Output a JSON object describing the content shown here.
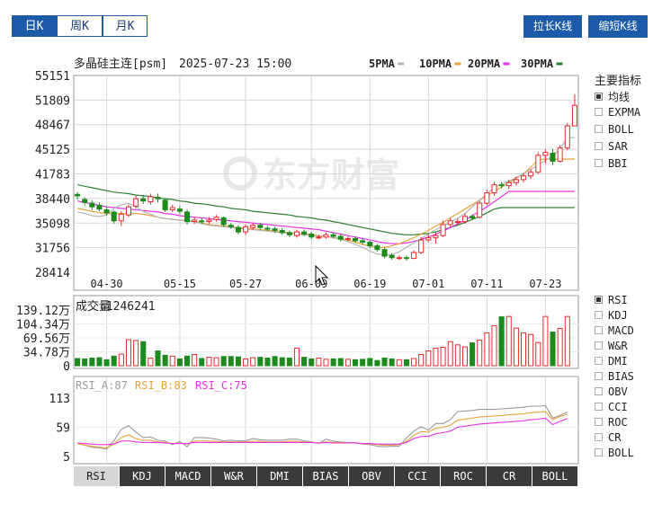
{
  "period_tabs": [
    {
      "label": "日K",
      "active": true
    },
    {
      "label": "周K",
      "active": false
    },
    {
      "label": "月K",
      "active": false
    }
  ],
  "right_buttons": {
    "stretch": "拉长K线",
    "shrink": "缩短K线"
  },
  "chart_header": {
    "name": "多晶硅主连[psm]",
    "datetime": "2025-07-23 15:00"
  },
  "ma_legend": [
    {
      "label": "5PMA",
      "color": "#b4b4b4"
    },
    {
      "label": "10PMA",
      "color": "#e8a33a"
    },
    {
      "label": "20PMA",
      "color": "#e633e6"
    },
    {
      "label": "30PMA",
      "color": "#2e7d32"
    }
  ],
  "indicator_menu": {
    "title": "主要指标",
    "items": [
      {
        "label": "均线",
        "selected": true
      },
      {
        "label": "EXPMA",
        "selected": false
      },
      {
        "label": "BOLL",
        "selected": false
      },
      {
        "label": "SAR",
        "selected": false
      },
      {
        "label": "BBI",
        "selected": false
      }
    ]
  },
  "sub_menu": {
    "items": [
      {
        "label": "RSI",
        "selected": true
      },
      {
        "label": "KDJ",
        "selected": false
      },
      {
        "label": "MACD",
        "selected": false
      },
      {
        "label": "W&R",
        "selected": false
      },
      {
        "label": "DMI",
        "selected": false
      },
      {
        "label": "BIAS",
        "selected": false
      },
      {
        "label": "OBV",
        "selected": false
      },
      {
        "label": "CCI",
        "selected": false
      },
      {
        "label": "ROC",
        "selected": false
      },
      {
        "label": "CR",
        "selected": false
      },
      {
        "label": "BOLL",
        "selected": false
      }
    ]
  },
  "bottom_tabs": [
    {
      "label": "RSI",
      "active": true
    },
    {
      "label": "KDJ",
      "active": false
    },
    {
      "label": "MACD",
      "active": false
    },
    {
      "label": "W&R",
      "active": false
    },
    {
      "label": "DMI",
      "active": false
    },
    {
      "label": "BIAS",
      "active": false
    },
    {
      "label": "OBV",
      "active": false
    },
    {
      "label": "CCI",
      "active": false
    },
    {
      "label": "ROC",
      "active": false
    },
    {
      "label": "CR",
      "active": false
    },
    {
      "label": "BOLL",
      "active": false
    }
  ],
  "watermark": "东方财富",
  "colors": {
    "up": "#e8292c",
    "down": "#1e8a1e",
    "accent": "#1d5aa8",
    "grid": "#d8d8d8"
  },
  "chart_data": {
    "type": "candlestick",
    "price_axis": {
      "ticks": [
        "55151",
        "51809",
        "48467",
        "45125",
        "41783",
        "38440",
        "35098",
        "31756",
        "28414"
      ],
      "range": [
        28414,
        55151
      ]
    },
    "x_ticks": [
      {
        "label": "04-30",
        "index": 4
      },
      {
        "label": "05-15",
        "index": 14
      },
      {
        "label": "05-27",
        "index": 23
      },
      {
        "label": "06-09",
        "index": 32
      },
      {
        "label": "06-19",
        "index": 40
      },
      {
        "label": "07-01",
        "index": 48
      },
      {
        "label": "07-11",
        "index": 56
      },
      {
        "label": "07-23",
        "index": 64
      }
    ],
    "candles": [
      [
        39000,
        38800,
        39300,
        38300
      ],
      [
        38300,
        37900,
        38600,
        37500
      ],
      [
        37800,
        37300,
        38200,
        36900
      ],
      [
        37500,
        37000,
        37900,
        36700
      ],
      [
        36900,
        36500,
        37300,
        36100
      ],
      [
        36600,
        35400,
        36800,
        35000
      ],
      [
        35400,
        36300,
        36700,
        34700
      ],
      [
        36200,
        37300,
        37600,
        35900
      ],
      [
        37400,
        38400,
        38800,
        37100
      ],
      [
        38400,
        38100,
        38900,
        37700
      ],
      [
        38000,
        38700,
        39100,
        37600
      ],
      [
        38600,
        38400,
        39100,
        37900
      ],
      [
        38200,
        36900,
        38500,
        36600
      ],
      [
        36900,
        37200,
        37600,
        36600
      ],
      [
        37000,
        36700,
        37400,
        36300
      ],
      [
        36600,
        35300,
        36900,
        34900
      ],
      [
        35300,
        35500,
        35900,
        35000
      ],
      [
        35400,
        35300,
        35800,
        35000
      ],
      [
        35300,
        35500,
        35900,
        35000
      ],
      [
        35600,
        35900,
        36200,
        35300
      ],
      [
        35800,
        34900,
        36000,
        34600
      ],
      [
        34800,
        34600,
        35100,
        34300
      ],
      [
        34500,
        33900,
        34800,
        33600
      ],
      [
        33900,
        34600,
        34900,
        33500
      ],
      [
        34500,
        34800,
        35100,
        34200
      ],
      [
        34800,
        34500,
        35100,
        34200
      ],
      [
        34400,
        34300,
        34700,
        34000
      ],
      [
        34300,
        34100,
        34600,
        33800
      ],
      [
        34100,
        33800,
        34400,
        33500
      ],
      [
        33800,
        33500,
        34100,
        33200
      ],
      [
        33400,
        33900,
        34200,
        33100
      ],
      [
        33900,
        33600,
        34200,
        33300
      ],
      [
        33600,
        33200,
        33900,
        32900
      ],
      [
        33200,
        33200,
        33500,
        32900
      ],
      [
        33200,
        33500,
        33800,
        33000
      ],
      [
        33500,
        33300,
        33800,
        33000
      ],
      [
        33300,
        32900,
        33600,
        32600
      ],
      [
        32900,
        33000,
        33300,
        32600
      ],
      [
        33000,
        32700,
        33300,
        32400
      ],
      [
        32700,
        32500,
        33000,
        32200
      ],
      [
        32500,
        32000,
        32700,
        31700
      ],
      [
        32000,
        31500,
        32300,
        31200
      ],
      [
        31500,
        30600,
        31800,
        30300
      ],
      [
        30700,
        30400,
        31000,
        30100
      ],
      [
        30400,
        30400,
        30700,
        30100
      ],
      [
        30400,
        30300,
        30700,
        30000
      ],
      [
        30300,
        31100,
        31400,
        30200
      ],
      [
        31100,
        32800,
        33200,
        30900
      ],
      [
        32800,
        33100,
        33600,
        32500
      ],
      [
        33100,
        33400,
        33800,
        32300
      ],
      [
        33400,
        34900,
        35400,
        33200
      ],
      [
        34900,
        35400,
        35800,
        34500
      ],
      [
        35300,
        35300,
        35700,
        34900
      ],
      [
        35300,
        36000,
        36400,
        35000
      ],
      [
        36000,
        35800,
        36300,
        35500
      ],
      [
        35900,
        37800,
        38100,
        35700
      ],
      [
        37800,
        39200,
        39600,
        37500
      ],
      [
        39200,
        40300,
        40700,
        38800
      ],
      [
        40300,
        40200,
        40700,
        39800
      ],
      [
        40200,
        40600,
        41000,
        39700
      ],
      [
        40600,
        41000,
        41400,
        40200
      ],
      [
        41000,
        41500,
        41900,
        40600
      ],
      [
        41500,
        42000,
        42400,
        41100
      ],
      [
        42000,
        44300,
        44700,
        41800
      ],
      [
        44300,
        44700,
        45100,
        43200
      ],
      [
        44600,
        43500,
        45200,
        43000
      ],
      [
        43500,
        45300,
        45700,
        43300
      ],
      [
        45300,
        48300,
        48700,
        45000
      ],
      [
        48300,
        51100,
        52600,
        49500
      ]
    ],
    "ma": {
      "ma5": [
        36600,
        36400,
        36100,
        36000,
        36200,
        37100,
        37600,
        37800,
        37300,
        36700,
        36300,
        35900,
        35700,
        35600,
        35500,
        35500,
        35300,
        35000,
        34800,
        34700,
        34600,
        34500,
        34400,
        34300,
        34200,
        34100,
        34000,
        33900,
        33800,
        33700,
        33600,
        33500,
        33400,
        33300,
        33300,
        33100,
        32900,
        32600,
        32200,
        31800,
        31300,
        30900,
        30800,
        30800,
        31200,
        31800,
        32400,
        33000,
        33600,
        34200,
        34700,
        35200,
        35700,
        36400,
        37300,
        38200,
        39100,
        39900,
        40400,
        40800,
        41300,
        41800,
        42400,
        43000,
        43600,
        44200,
        45200,
        46700,
        46700,
        46800
      ],
      "ma10": [
        37100,
        36900,
        36700,
        36500,
        36400,
        36400,
        36400,
        36400,
        36400,
        36300,
        36100,
        35900,
        35700,
        35600,
        35500,
        35400,
        35300,
        35100,
        34900,
        34800,
        34700,
        34600,
        34500,
        34400,
        34300,
        34200,
        34100,
        34000,
        33900,
        33800,
        33700,
        33600,
        33500,
        33400,
        33300,
        33100,
        33000,
        32800,
        32500,
        32200,
        32000,
        31800,
        31800,
        32000,
        32300,
        32700,
        33100,
        33600,
        34100,
        34700,
        35200,
        35800,
        36400,
        37000,
        37600,
        38200,
        38800,
        39400,
        40000,
        40600,
        41200,
        41800,
        42700,
        43700,
        43800,
        43800,
        43800,
        43800,
        43800,
        43800
      ],
      "ma20": [
        38100,
        37900,
        37700,
        37500,
        37300,
        37200,
        37100,
        37000,
        36900,
        36800,
        36700,
        36600,
        36400,
        36300,
        36100,
        36000,
        35900,
        35800,
        35700,
        35600,
        35500,
        35400,
        35300,
        35200,
        35100,
        35000,
        34900,
        34800,
        34700,
        34600,
        34500,
        34400,
        34300,
        34200,
        34000,
        33800,
        33600,
        33400,
        33200,
        33000,
        32800,
        32600,
        32400,
        32300,
        32300,
        32400,
        32600,
        32900,
        33200,
        33600,
        34000,
        34500,
        35000,
        35500,
        36100,
        36700,
        37300,
        38000,
        38700,
        39400,
        39400,
        39400,
        39400,
        39400,
        39400,
        39400,
        39400,
        39400,
        39400,
        39400
      ],
      "ma30": [
        40300,
        40100,
        39900,
        39700,
        39500,
        39300,
        39200,
        39100,
        38900,
        38800,
        38700,
        38500,
        38400,
        38300,
        38100,
        38000,
        37800,
        37700,
        37600,
        37400,
        37300,
        37100,
        37000,
        36900,
        36700,
        36600,
        36500,
        36400,
        36300,
        36200,
        36000,
        35900,
        35800,
        35600,
        35500,
        35300,
        35100,
        34900,
        34700,
        34500,
        34300,
        34100,
        33900,
        33700,
        33600,
        33500,
        33500,
        33600,
        33700,
        33900,
        34200,
        34500,
        34800,
        35200,
        35600,
        36000,
        36500,
        37000,
        37200,
        37200,
        37200,
        37200,
        37200,
        37200,
        37200,
        37200,
        37200,
        37200,
        37200,
        37200
      ]
    },
    "volume": {
      "label": "成交量",
      "value": "1246241",
      "ticks": [
        "139.12万",
        "104.34万",
        "69.56万",
        "34.78万",
        "0"
      ],
      "range": [
        0,
        1391200
      ],
      "values": [
        180000,
        170000,
        190000,
        200000,
        150000,
        240000,
        290000,
        650000,
        630000,
        600000,
        190000,
        370000,
        260000,
        240000,
        170000,
        240000,
        280000,
        180000,
        210000,
        200000,
        230000,
        230000,
        220000,
        170000,
        200000,
        210000,
        190000,
        230000,
        200000,
        190000,
        440000,
        210000,
        170000,
        190000,
        160000,
        170000,
        180000,
        160000,
        150000,
        160000,
        180000,
        130000,
        190000,
        170000,
        150000,
        150000,
        180000,
        280000,
        370000,
        440000,
        460000,
        600000,
        520000,
        470000,
        570000,
        640000,
        820000,
        1000000,
        1220000,
        1230000,
        940000,
        820000,
        780000,
        580000,
        1230000,
        840000,
        930000,
        1230000
      ]
    },
    "rsi": {
      "legend": [
        {
          "label": "RSI_A:87",
          "color": "#9a9a9a"
        },
        {
          "label": "RSI_B:83",
          "color": "#e8a33a"
        },
        {
          "label": "RSI_C:75",
          "color": "#e633e6"
        }
      ],
      "ticks": [
        "113",
        "59",
        "5"
      ],
      "range": [
        5,
        113
      ],
      "rsi_a": [
        30,
        26,
        22,
        21,
        19,
        34,
        55,
        62,
        50,
        40,
        41,
        35,
        33,
        27,
        33,
        23,
        40,
        40,
        39,
        37,
        34,
        35,
        34,
        34,
        38,
        36,
        35,
        35,
        35,
        37,
        37,
        34,
        32,
        29,
        37,
        33,
        32,
        31,
        31,
        28,
        27,
        24,
        23,
        24,
        24,
        39,
        52,
        60,
        54,
        66,
        66,
        73,
        88,
        89,
        90,
        92,
        92,
        92,
        93,
        94,
        95,
        96,
        98,
        98,
        99,
        76,
        81,
        87
      ],
      "rsi_b": [
        29,
        26,
        24,
        22,
        21,
        28,
        40,
        45,
        38,
        35,
        35,
        32,
        31,
        29,
        30,
        28,
        33,
        34,
        33,
        33,
        32,
        32,
        32,
        32,
        33,
        33,
        32,
        32,
        32,
        33,
        33,
        32,
        31,
        30,
        32,
        31,
        31,
        30,
        30,
        29,
        28,
        27,
        26,
        26,
        27,
        33,
        44,
        51,
        50,
        57,
        59,
        63,
        72,
        74,
        76,
        78,
        79,
        80,
        81,
        82,
        83,
        84,
        86,
        87,
        88,
        73,
        79,
        83
      ],
      "rsi_c": [
        30,
        29,
        28,
        27,
        27,
        28,
        33,
        34,
        32,
        31,
        31,
        31,
        30,
        29,
        29,
        29,
        31,
        31,
        31,
        31,
        31,
        31,
        31,
        31,
        31,
        31,
        31,
        31,
        31,
        31,
        31,
        31,
        31,
        30,
        31,
        30,
        30,
        30,
        30,
        29,
        29,
        28,
        28,
        28,
        28,
        31,
        38,
        42,
        42,
        47,
        49,
        52,
        59,
        61,
        63,
        65,
        66,
        67,
        68,
        69,
        70,
        71,
        73,
        74,
        76,
        64,
        70,
        75
      ]
    }
  }
}
